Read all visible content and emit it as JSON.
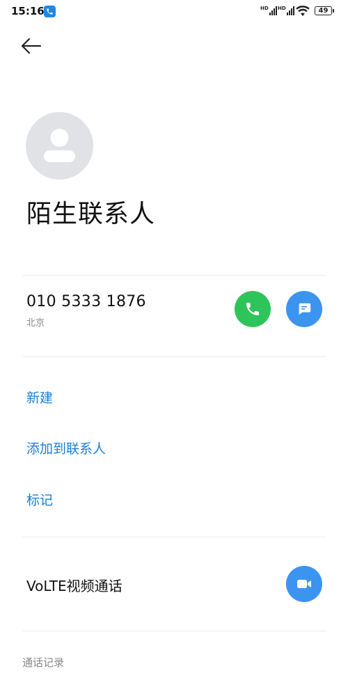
{
  "status_bar": {
    "time": "15:16",
    "signal_hd_1": "HD",
    "signal_hd_2": "HD",
    "battery": "49"
  },
  "contact": {
    "name": "陌生联系人",
    "phone_number": "010 5333 1876",
    "location": "北京"
  },
  "actions": {
    "new": "新建",
    "add_to_contacts": "添加到联系人",
    "mark": "标记"
  },
  "volte": {
    "label": "VoLTE视频通话"
  },
  "call_log": {
    "header": "通话记录"
  },
  "colors": {
    "link": "#1b7fd8",
    "call_green": "#2fc45a",
    "accent_blue": "#3b94f0",
    "avatar_bg": "#e0e2e6"
  },
  "icons": [
    "back-arrow-icon",
    "app-notification-icon",
    "wifi-icon",
    "battery-icon",
    "avatar-placeholder-icon",
    "phone-icon",
    "message-icon",
    "video-camera-icon"
  ]
}
